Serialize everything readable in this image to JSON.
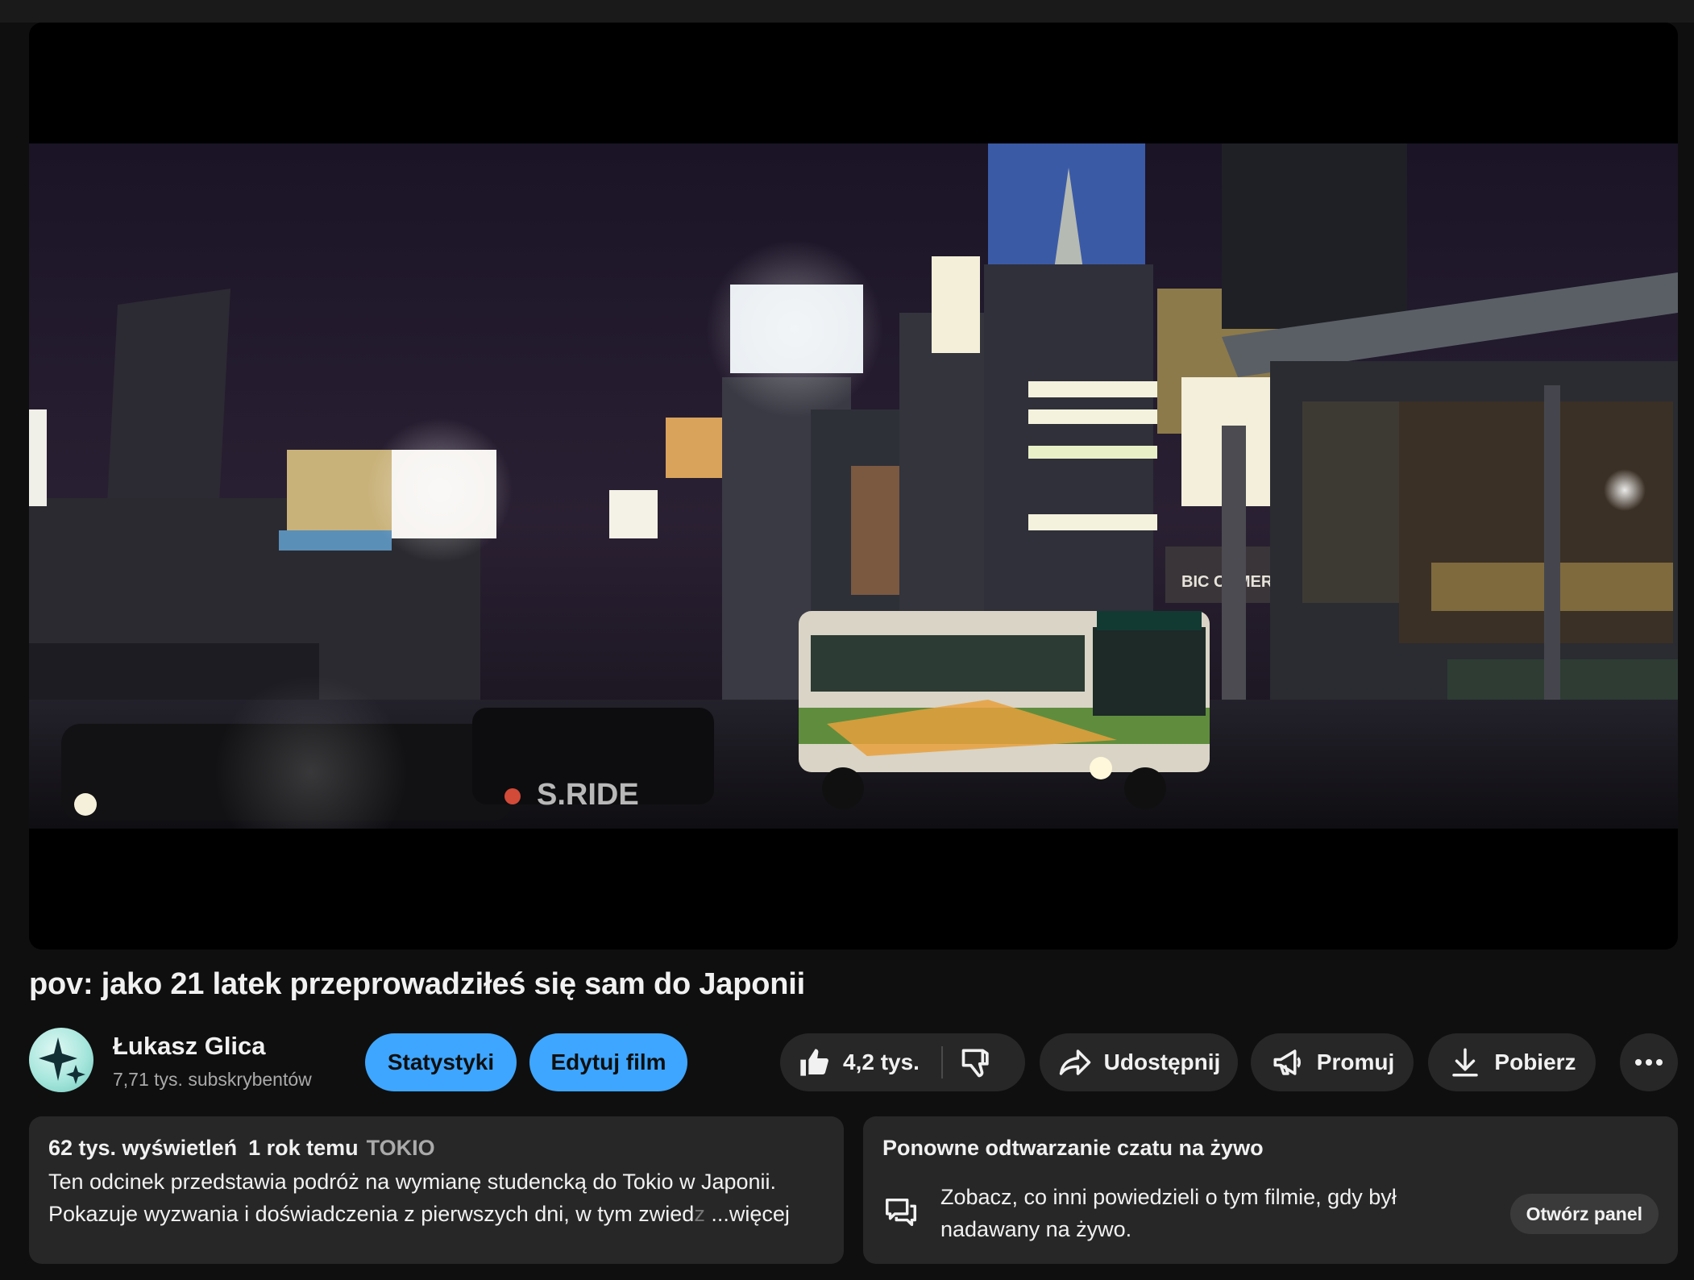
{
  "video": {
    "title": "pov: jako 21 latek przeprowadziłeś się sam do Japonii"
  },
  "channel": {
    "name": "Łukasz Glica",
    "subscribers": "7,71 tys. subskrybentów"
  },
  "actions": {
    "stats_label": "Statystyki",
    "edit_label": "Edytuj film",
    "likes": "4,2 tys.",
    "share_label": "Udostępnij",
    "promote_label": "Promuj",
    "download_label": "Pobierz"
  },
  "description": {
    "views": "62 tys. wyświetleń",
    "age": "1 rok temu",
    "tag": "TOKIO",
    "line1": "Ten odcinek przedstawia podróż na wymianę studencką do Tokio w Japonii.",
    "line2": "Pokazuje wyzwania i doświadczenia z pierwszych dni, w tym zwied",
    "line2_fade": "z",
    "more": "...więcej"
  },
  "live_chat": {
    "title": "Ponowne odtwarzanie czatu na żywo",
    "text": "Zobacz, co inni powiedzieli o tym filmie, gdy był nadawany na żywo.",
    "button": "Otwórz panel"
  },
  "scene_text": {
    "bus_side": "S.RIDE",
    "store_sign": "BIC CAMERA"
  },
  "colors": {
    "background": "#0f0f0f",
    "surface": "#272727",
    "accent_blue": "#3ea6ff",
    "text_primary": "#f1f1f1",
    "text_secondary": "#aaaaaa"
  },
  "icons": [
    "thumbs-up-icon",
    "thumbs-down-icon",
    "share-icon",
    "megaphone-icon",
    "download-icon",
    "more-icon",
    "chat-icon",
    "sparkle-avatar"
  ]
}
